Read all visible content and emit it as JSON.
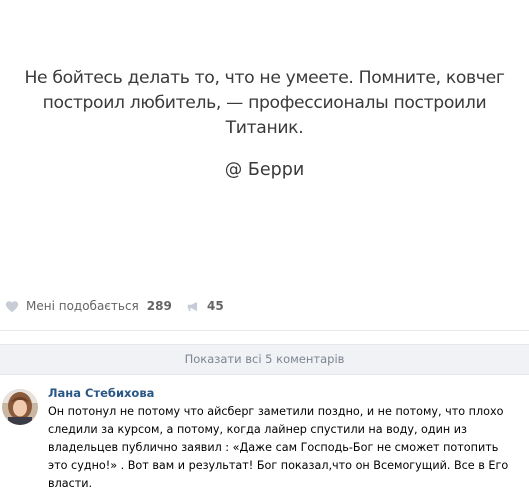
{
  "post": {
    "quote_line1": "Не бойтесь делать то, что не умеете. Помните, ковчег",
    "quote_line2": "построил любитель, — профессионалы построили",
    "quote_line3": "Титаник.",
    "author": "@ Берри"
  },
  "actions": {
    "like_label": "Мені подобається",
    "like_count": "289",
    "share_count": "45",
    "like_icon": "heart-icon",
    "share_icon": "megaphone-icon"
  },
  "comments_toggle": {
    "label": "Показати всі 5 коментарів"
  },
  "comment": {
    "author": "Лана Стебихова",
    "text": "Он потонул не потому что айсберг заметили поздно, и не потому, что плохо следили за курсом, а потому, когда лайнер спустили на воду, один из владельцев публично заявил : «Даже сам Господь-Бог не сможет потопить это судно!» . Вот вам и результат! Бог показал,что он Всемогущий. Все в Его власти."
  },
  "colors": {
    "link": "#2a5885",
    "muted": "#828282",
    "panel": "#f0f2f5"
  }
}
